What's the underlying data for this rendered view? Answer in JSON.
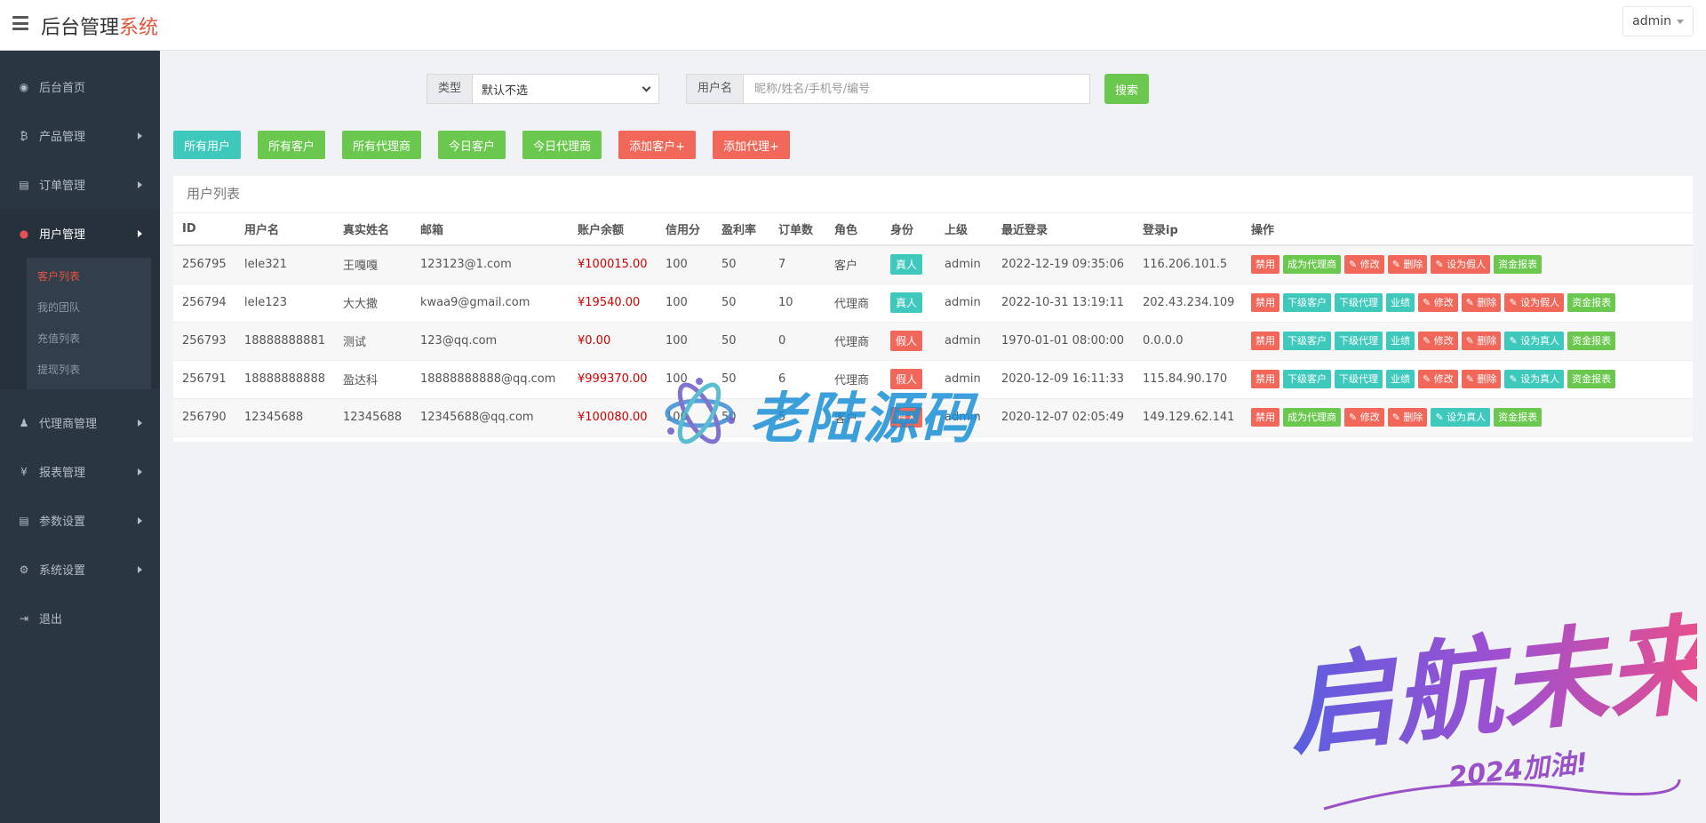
{
  "header": {
    "brand_main": "后台管理",
    "brand_accent": "系统",
    "user": "admin"
  },
  "sidebar": {
    "items": [
      {
        "label": "后台首页",
        "icon": "dashboard-icon",
        "glyph": "◉"
      },
      {
        "label": "产品管理",
        "icon": "bitcoin-icon",
        "glyph": "₿"
      },
      {
        "label": "订单管理",
        "icon": "copy-icon",
        "glyph": "▤"
      },
      {
        "label": "用户管理",
        "icon": "user-icon",
        "glyph": "●"
      },
      {
        "label": "代理商管理",
        "icon": "users-icon",
        "glyph": "♟"
      },
      {
        "label": "报表管理",
        "icon": "yen-icon",
        "glyph": "¥"
      },
      {
        "label": "参数设置",
        "icon": "copy-icon",
        "glyph": "▤"
      },
      {
        "label": "系统设置",
        "icon": "gears-icon",
        "glyph": "⚙"
      },
      {
        "label": "退出",
        "icon": "sign-out-icon",
        "glyph": "⇥"
      }
    ],
    "sub_items": [
      "客户列表",
      "我的团队",
      "充值列表",
      "提现列表"
    ]
  },
  "search": {
    "type_label": "类型",
    "type_value": "默认不选",
    "username_label": "用户名",
    "username_placeholder": "昵称/姓名/手机号/编号",
    "search_button": "搜索"
  },
  "filters": [
    "所有用户",
    "所有客户",
    "所有代理商",
    "今日客户",
    "今日代理商",
    "添加客户+",
    "添加代理+"
  ],
  "table": {
    "title": "用户列表",
    "headers": [
      "ID",
      "用户名",
      "真实姓名",
      "邮箱",
      "账户余额",
      "信用分",
      "盈利率",
      "订单数",
      "角色",
      "身份",
      "上级",
      "最近登录",
      "登录ip",
      "操作"
    ],
    "rows": [
      {
        "id": "256795",
        "username": "lele321",
        "realname": "王嘎嘎",
        "email": "123123@1.com",
        "balance": "¥100015.00",
        "credit": "100",
        "profit": "50",
        "orders": "7",
        "role": "客户",
        "identity": "真人",
        "parent": "admin",
        "last_login": "2022-12-19 09:35:06",
        "ip": "116.206.101.5",
        "ops": [
          "禁用",
          "成为代理商",
          "✎ 修改",
          "✎ 删除",
          "✎ 设为假人",
          "资金报表"
        ]
      },
      {
        "id": "256794",
        "username": "lele123",
        "realname": "大大撒",
        "email": "kwaa9@gmail.com",
        "balance": "¥19540.00",
        "credit": "100",
        "profit": "50",
        "orders": "10",
        "role": "代理商",
        "identity": "真人",
        "parent": "admin",
        "last_login": "2022-10-31 13:19:11",
        "ip": "202.43.234.109",
        "ops": [
          "禁用",
          "下级客户",
          "下级代理",
          "业绩",
          "✎ 修改",
          "✎ 删除",
          "✎ 设为假人",
          "资金报表"
        ]
      },
      {
        "id": "256793",
        "username": "18888888881",
        "realname": "测试",
        "email": "123@qq.com",
        "balance": "¥0.00",
        "credit": "100",
        "profit": "50",
        "orders": "0",
        "role": "代理商",
        "identity": "假人",
        "parent": "admin",
        "last_login": "1970-01-01 08:00:00",
        "ip": "0.0.0.0",
        "ops": [
          "禁用",
          "下级客户",
          "下级代理",
          "业绩",
          "✎ 修改",
          "✎ 删除",
          "✎ 设为真人",
          "资金报表"
        ]
      },
      {
        "id": "256791",
        "username": "18888888888",
        "realname": "盈达科",
        "email": "18888888888@qq.com",
        "balance": "¥999370.00",
        "credit": "100",
        "profit": "50",
        "orders": "6",
        "role": "代理商",
        "identity": "假人",
        "parent": "admin",
        "last_login": "2020-12-09 16:11:33",
        "ip": "115.84.90.170",
        "ops": [
          "禁用",
          "下级客户",
          "下级代理",
          "业绩",
          "✎ 修改",
          "✎ 删除",
          "✎ 设为真人",
          "资金报表"
        ]
      },
      {
        "id": "256790",
        "username": "12345688",
        "realname": "12345688",
        "email": "12345688@qq.com",
        "balance": "¥100080.00",
        "credit": "100",
        "profit": "50",
        "orders": "5",
        "role": "客户",
        "identity": "假人",
        "parent": "admin",
        "last_login": "2020-12-07 02:05:49",
        "ip": "149.129.62.141",
        "ops": [
          "禁用",
          "成为代理商",
          "✎ 修改",
          "✎ 删除",
          "✎ 设为真人",
          "资金报表"
        ]
      }
    ]
  },
  "watermark": {
    "text": "老陆源码",
    "slogan": "启航未来",
    "sub": "2024加油!"
  },
  "colors": {
    "teal": "#3fc9bd",
    "green": "#6bc84f",
    "red": "#f1675a",
    "sidebar": "#2b3643",
    "accent": "#e4553d"
  }
}
